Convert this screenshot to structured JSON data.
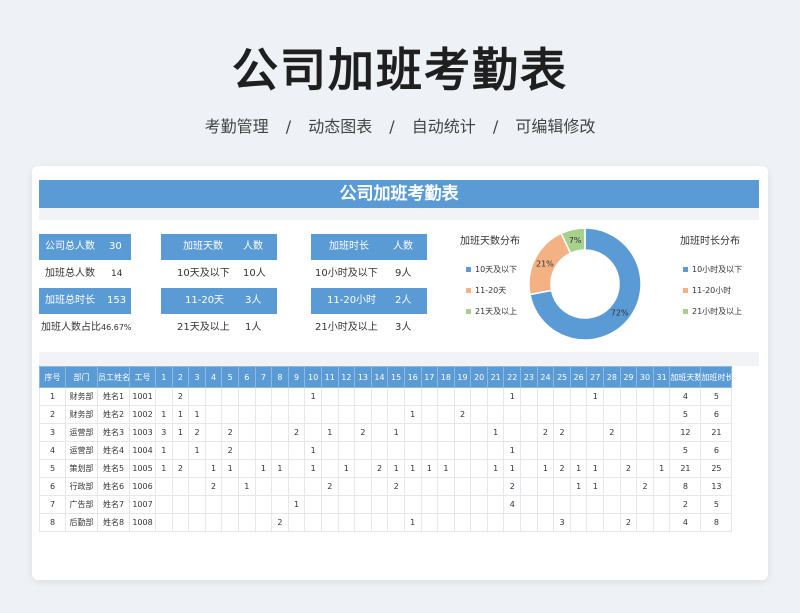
{
  "page": {
    "title": "公司加班考勤表",
    "subtitle": [
      "考勤管理",
      "/",
      "动态图表",
      "/",
      "自动统计",
      "/",
      "可编辑修改"
    ]
  },
  "sheet": {
    "banner": "公司加班考勤表",
    "stats": {
      "total_label": "公司总人数",
      "total_value": "30",
      "ot_people_label": "加班总人数",
      "ot_people_value": "14",
      "ot_hours_label": "加班总时长",
      "ot_hours_value": "153",
      "ratio_label": "加班人数占比",
      "ratio_value": "46.67%"
    },
    "days_table": {
      "header_left": "加班天数",
      "header_right": "人数",
      "rows": [
        {
          "label": "10天及以下",
          "value": "10人"
        },
        {
          "label": "11-20天",
          "value": "3人"
        },
        {
          "label": "21天及以上",
          "value": "1人"
        }
      ]
    },
    "hours_table": {
      "header_left": "加班时长",
      "header_right": "人数",
      "rows": [
        {
          "label": "10小时及以下",
          "value": "9人"
        },
        {
          "label": "11-20小时",
          "value": "2人"
        },
        {
          "label": "21小时及以上",
          "value": "3人"
        }
      ]
    },
    "donut_title_left": "加班天数分布",
    "donut_title_right": "加班时长分布",
    "legend_days": [
      "10天及以下",
      "11-20天",
      "21天及以上"
    ],
    "legend_hours": [
      "10小时及以下",
      "11-20小时",
      "21小时及以上"
    ],
    "colors": {
      "blue": "#5b9bd5",
      "orange": "#f4b183",
      "green": "#a9d18e"
    },
    "table": {
      "headers": [
        "序号",
        "部门",
        "员工姓名",
        "工号",
        "1",
        "2",
        "3",
        "4",
        "5",
        "6",
        "7",
        "8",
        "9",
        "10",
        "11",
        "12",
        "13",
        "14",
        "15",
        "16",
        "17",
        "18",
        "19",
        "20",
        "21",
        "22",
        "23",
        "24",
        "25",
        "26",
        "27",
        "28",
        "29",
        "30",
        "31",
        "加班天数",
        "加班时长"
      ],
      "rows": [
        [
          "1",
          "财务部",
          "姓名1",
          "1001",
          "",
          "2",
          "",
          "",
          "",
          "",
          "",
          "",
          "",
          "1",
          "",
          "",
          "",
          "",
          "",
          "",
          "",
          "",
          "",
          "",
          "",
          "1",
          "",
          "",
          "",
          "",
          "1",
          "",
          "",
          "",
          "",
          "4",
          "5"
        ],
        [
          "2",
          "财务部",
          "姓名2",
          "1002",
          "1",
          "1",
          "1",
          "",
          "",
          "",
          "",
          "",
          "",
          "",
          "",
          "",
          "",
          "",
          "",
          "1",
          "",
          "",
          "2",
          "",
          "",
          "",
          "",
          "",
          "",
          "",
          "",
          "",
          "",
          "",
          "",
          "5",
          "6"
        ],
        [
          "3",
          "运营部",
          "姓名3",
          "1003",
          "3",
          "1",
          "2",
          "",
          "2",
          "",
          "",
          "",
          "2",
          "",
          "1",
          "",
          "2",
          "",
          "1",
          "",
          "",
          "",
          "",
          "",
          "1",
          "",
          "",
          "2",
          "2",
          "",
          "",
          "2",
          "",
          "",
          "",
          "12",
          "21"
        ],
        [
          "4",
          "运营部",
          "姓名4",
          "1004",
          "1",
          "",
          "1",
          "",
          "2",
          "",
          "",
          "",
          "",
          "1",
          "",
          "",
          "",
          "",
          "",
          "",
          "",
          "",
          "",
          "",
          "",
          "1",
          "",
          "",
          "",
          "",
          "",
          "",
          "",
          "",
          "",
          "5",
          "6"
        ],
        [
          "5",
          "策划部",
          "姓名5",
          "1005",
          "1",
          "2",
          "",
          "1",
          "1",
          "",
          "1",
          "1",
          "",
          "1",
          "",
          "1",
          "",
          "2",
          "1",
          "1",
          "1",
          "1",
          "",
          "",
          "1",
          "1",
          "",
          "1",
          "2",
          "1",
          "1",
          "",
          "2",
          "",
          "1",
          "21",
          "25"
        ],
        [
          "6",
          "行政部",
          "姓名6",
          "1006",
          "",
          "",
          "",
          "2",
          "",
          "1",
          "",
          "",
          "",
          "",
          "2",
          "",
          "",
          "",
          "2",
          "",
          "",
          "",
          "",
          "",
          "",
          "2",
          "",
          "",
          "",
          "1",
          "1",
          "",
          "",
          "2",
          "",
          "8",
          "13"
        ],
        [
          "7",
          "广告部",
          "姓名7",
          "1007",
          "",
          "",
          "",
          "",
          "",
          "",
          "",
          "",
          "1",
          "",
          "",
          "",
          "",
          "",
          "",
          "",
          "",
          "",
          "",
          "",
          "",
          "4",
          "",
          "",
          "",
          "",
          "",
          "",
          "",
          "",
          "",
          "2",
          "5"
        ],
        [
          "8",
          "后勤部",
          "姓名8",
          "1008",
          "",
          "",
          "",
          "",
          "",
          "",
          "",
          "2",
          "",
          "",
          "",
          "",
          "",
          "",
          "",
          "1",
          "",
          "",
          "",
          "",
          "",
          "",
          "",
          "",
          "3",
          "",
          "",
          "",
          "2",
          "",
          "",
          "4",
          "8"
        ]
      ]
    }
  },
  "chart_data": {
    "type": "pie",
    "title": "加班天数分布",
    "categories": [
      "10天及以下",
      "11-20天",
      "21天及以上"
    ],
    "values": [
      72,
      21,
      7
    ],
    "value_labels": [
      "72%",
      "21%",
      "7%"
    ],
    "colors": [
      "#5b9bd5",
      "#f4b183",
      "#a9d18e"
    ],
    "legend_right_title": "加班时长分布",
    "legend_right": [
      "10小时及以下",
      "11-20小时",
      "21小时及以上"
    ]
  }
}
